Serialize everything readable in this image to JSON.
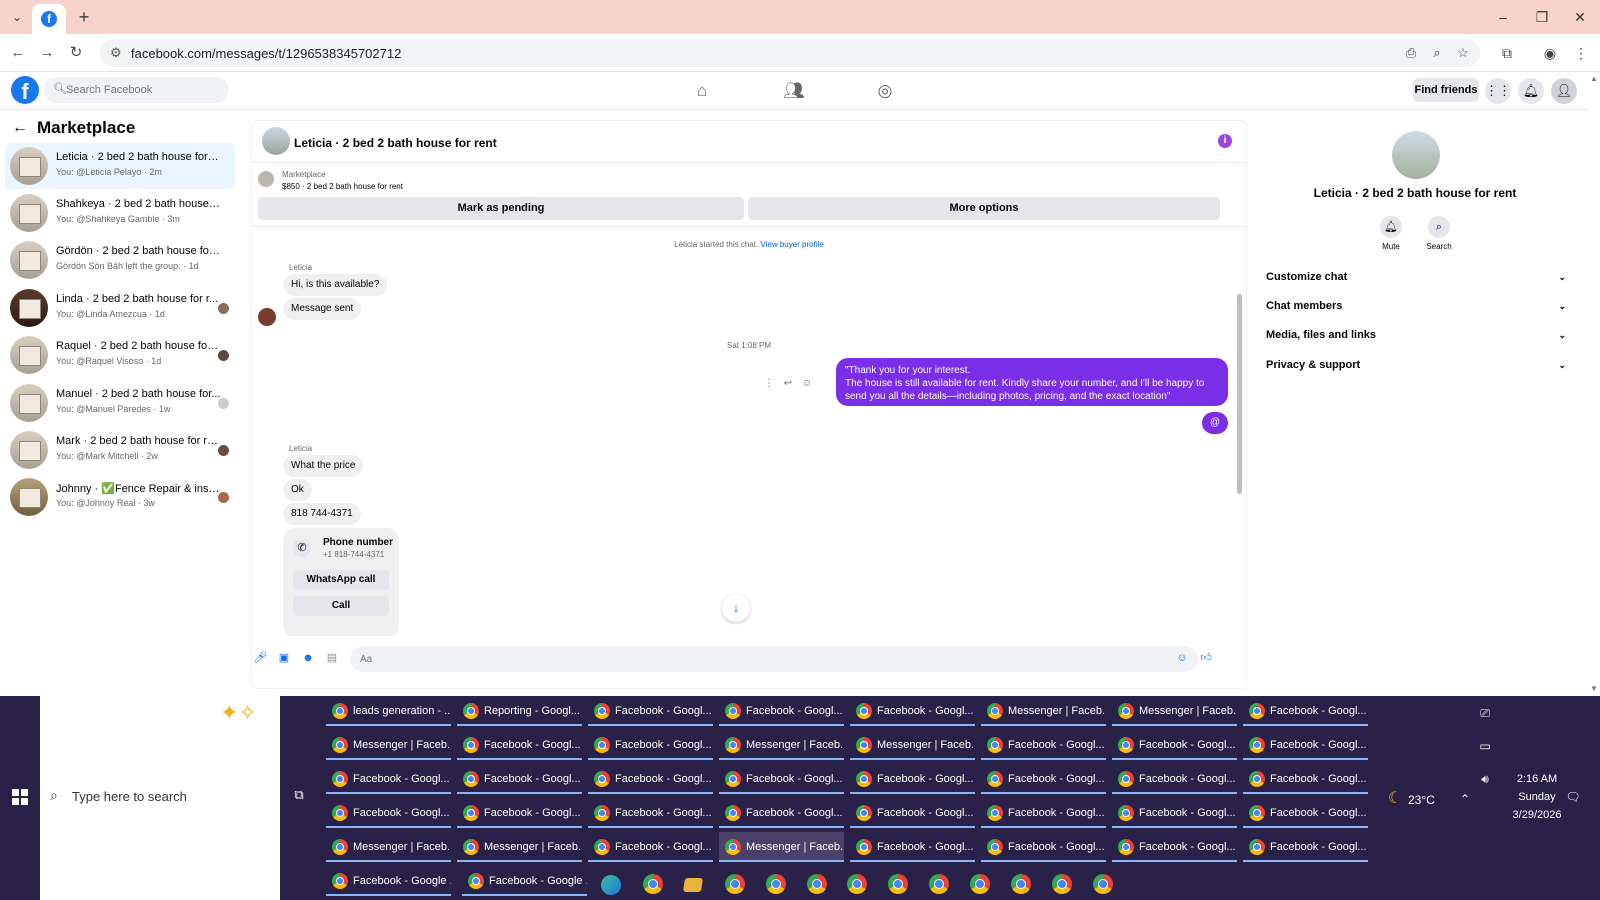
{
  "browser": {
    "url": "facebook.com/messages/t/1296538345702712",
    "window_controls": [
      "–",
      "❐",
      "✕"
    ]
  },
  "fb": {
    "search_placeholder": "Search Facebook",
    "find_friends": "Find friends"
  },
  "left": {
    "title": "Marketplace",
    "conversations": [
      {
        "name": "Leticia · 2 bed 2 bath house for rent",
        "sub": "You: @Leticia Pelayo · 2m",
        "active": true
      },
      {
        "name": "Shahkeya · 2 bed 2 bath house for ...",
        "sub": "You: @Shahkeya Gamble · 3m"
      },
      {
        "name": "Gördön · 2 bed 2 bath house for re...",
        "sub": "Gördön Sön Bâh left the group. · 1d"
      },
      {
        "name": "Linda · 2 bed 2 bath house for r...",
        "sub": "You: @Linda Amezcua · 1d"
      },
      {
        "name": "Raquel · 2 bed 2 bath house for ...",
        "sub": "You: @Raquel Visoso · 1d"
      },
      {
        "name": "Manuel · 2 bed 2 bath house for...",
        "sub": "You: @Manuel Paredes · 1w"
      },
      {
        "name": "Mark · 2 bed 2 bath house for re...",
        "sub": "You: @Mark Mitchell · 2w"
      },
      {
        "name": "Johnny · ✅Fence Repair & insta...",
        "sub": "You: @Johnny Real · 3w"
      }
    ]
  },
  "chat": {
    "title": "Leticia · 2 bed 2 bath house for rent",
    "info_glyph": "i",
    "listing": {
      "source": "Marketplace",
      "price_line": "$850 · 2 bed 2 bath house for rent",
      "mark_pending": "Mark as pending",
      "more_options": "More options"
    },
    "started": "Leticia started this chat.",
    "view_profile": "View buyer profile",
    "sender": "Leticia",
    "msg1": "Hi, is this available?",
    "msg2": "Message sent",
    "timestamp": "Sat 1:08 PM",
    "outgoing_line1": "\"Thank you for your interest.",
    "outgoing_line2": "The house is still available for rent. Kindly share your number, and I'll be happy to send you all the details—including photos, pricing, and the exact location\"",
    "at_reply": "@",
    "sender2": "Leticia",
    "msg3": "What the price",
    "msg4": "Ok",
    "msg5": "818 744-4371",
    "phone_card": {
      "title": "Phone number",
      "number": "+1 818-744-4371",
      "whatsapp": "WhatsApp call",
      "call": "Call"
    },
    "composer_placeholder": "Aa"
  },
  "right": {
    "title": "Leticia · 2 bed 2 bath house for rent",
    "mute": "Mute",
    "search": "Search",
    "sections": [
      "Customize chat",
      "Chat members",
      "Media, files and links",
      "Privacy & support"
    ]
  },
  "taskbar": {
    "search_placeholder": "Type here to search",
    "buttons": [
      [
        "leads generation - ...",
        "Reporting - Googl...",
        "Facebook - Googl...",
        "Facebook - Googl...",
        "Facebook - Googl...",
        "Messenger | Faceb...",
        "Messenger | Faceb...",
        "Facebook - Googl..."
      ],
      [
        "Messenger | Faceb...",
        "Facebook - Googl...",
        "Facebook - Googl...",
        "Messenger | Faceb...",
        "Messenger | Faceb...",
        "Facebook - Googl...",
        "Facebook - Googl...",
        "Facebook - Googl..."
      ],
      [
        "Facebook - Googl...",
        "Facebook - Googl...",
        "Facebook - Googl...",
        "Facebook - Googl...",
        "Facebook - Googl...",
        "Facebook - Googl...",
        "Facebook - Googl...",
        "Facebook - Googl..."
      ],
      [
        "Facebook - Googl...",
        "Facebook - Googl...",
        "Facebook - Googl...",
        "Facebook - Googl...",
        "Facebook - Googl...",
        "Facebook - Googl...",
        "Facebook - Googl...",
        "Facebook - Googl..."
      ],
      [
        "Messenger | Faceb...",
        "Messenger | Faceb...",
        "Facebook - Googl...",
        "Messenger | Faceb...",
        "Facebook - Googl...",
        "Facebook - Googl...",
        "Facebook - Googl...",
        "Facebook - Googl..."
      ]
    ],
    "active_button": [
      4,
      3
    ],
    "last_row": [
      "Facebook - Google ...",
      "Facebook - Google ..."
    ],
    "weather": "23°C",
    "time": "2:16 AM",
    "day": "Sunday",
    "date": "3/29/2026"
  },
  "colors": {
    "fb_blue": "#1877f2",
    "messenger_purple": "#7a2ee8",
    "tab_strip": "#f6d3cc",
    "taskbar": "#2a2148"
  }
}
